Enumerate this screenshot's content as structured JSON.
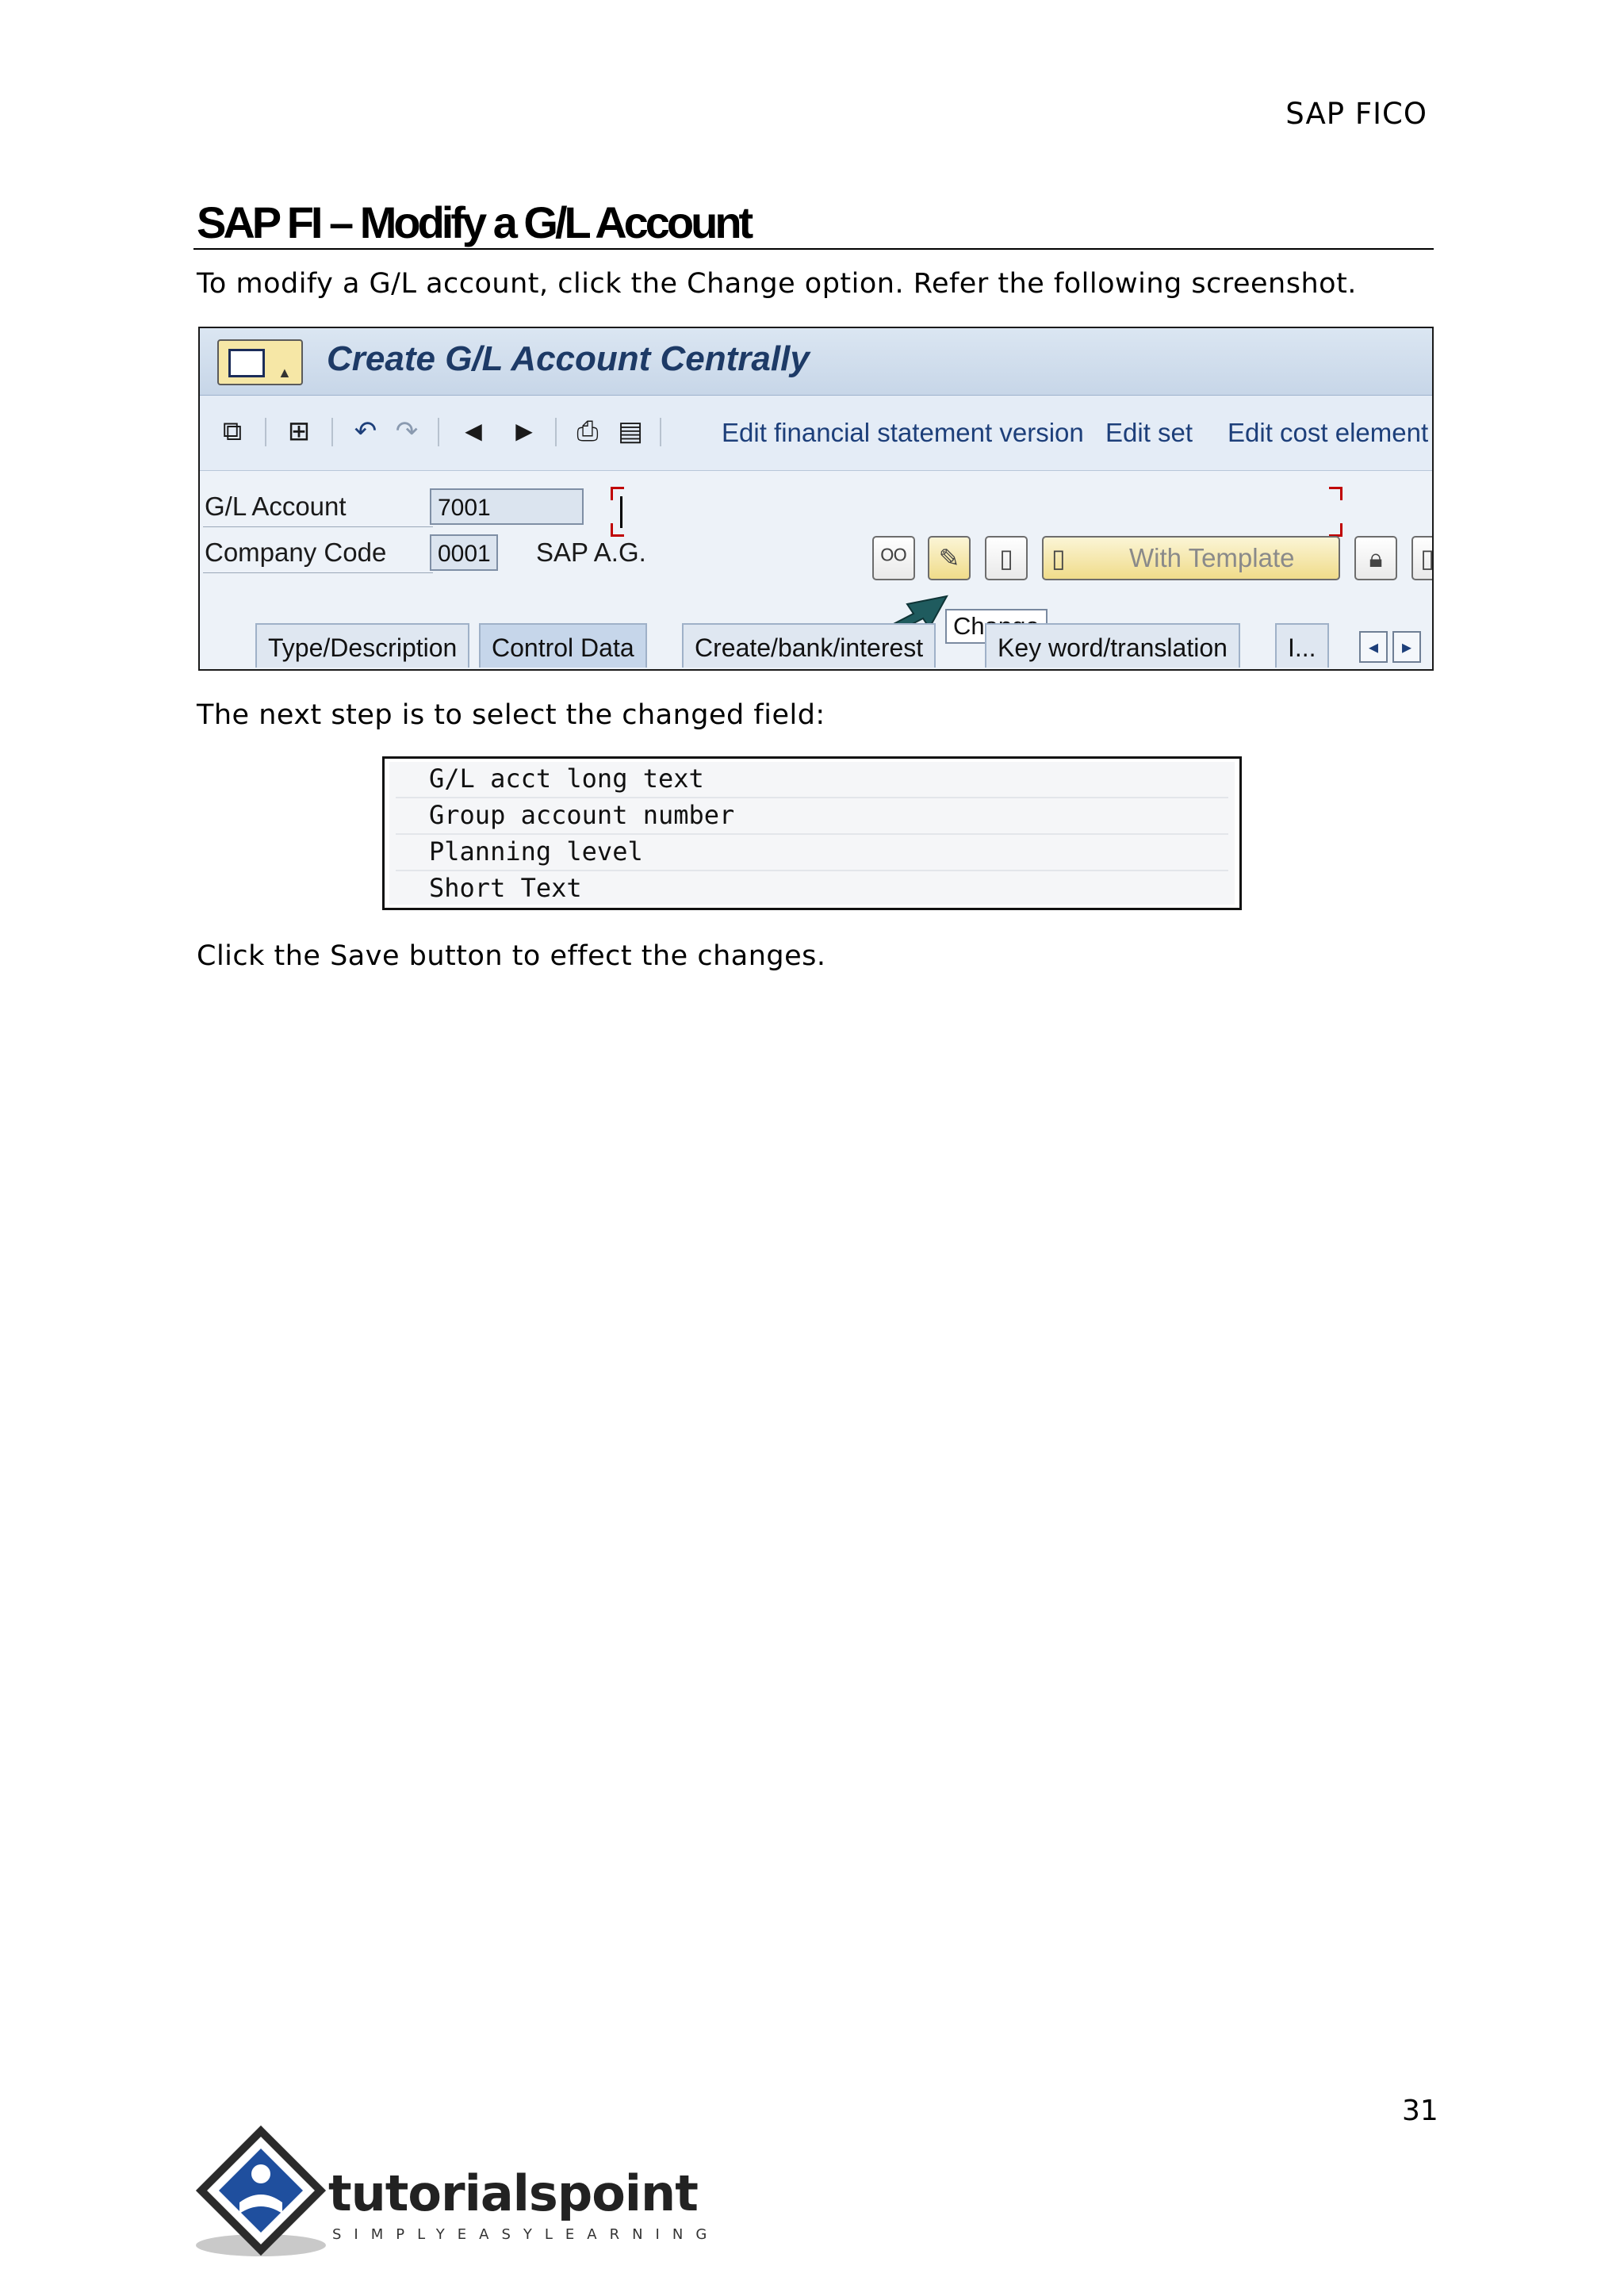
{
  "header": {
    "running_title": "SAP FICO"
  },
  "section": {
    "title": "SAP FI – Modify a G/L Account",
    "intro": "To modify a G/L account, click the Change option. Refer the following screenshot.",
    "step2": "The next step is to select the changed field:",
    "step3": "Click the Save button to effect the changes."
  },
  "sap_screen": {
    "window_title": "Create G/L Account Centrally",
    "toolbar_links": [
      "Edit financial statement version",
      "Edit set",
      "Edit cost element"
    ],
    "fields": {
      "gl_account_label": "G/L Account",
      "gl_account_value": "7001",
      "company_code_label": "Company Code",
      "company_code_value": "0001",
      "company_name": "SAP A.G."
    },
    "buttons": {
      "with_template": "With Template"
    },
    "tooltip": "Change",
    "tabs": [
      "Type/Description",
      "Control Data",
      "Create/bank/interest",
      "Key word/translation",
      "I..."
    ],
    "active_tab": "Control Data"
  },
  "field_list": [
    "G/L acct long text",
    "Group account number",
    "Planning level",
    "Short Text"
  ],
  "footer": {
    "page_number": "31",
    "logo_text": "tutorialspoint",
    "logo_tagline": "SIMPLYEASYLEARNING"
  },
  "colors": {
    "sap_title": "#1d3a66",
    "sap_links": "#1d3f7a",
    "arrow": "#1f5b5e"
  },
  "icons": [
    "menu-icon",
    "create-icon",
    "hierarchy-icon",
    "back-icon",
    "forward-icon",
    "prev-icon",
    "next-icon",
    "print-icon",
    "document-icon",
    "display-glasses-icon",
    "change-pencil-icon",
    "new-document-icon",
    "lock-icon"
  ]
}
